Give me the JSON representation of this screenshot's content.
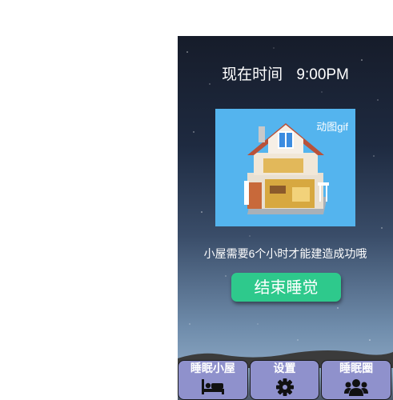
{
  "header": {
    "label": "现在时间",
    "time": "9:00PM"
  },
  "animation": {
    "label": "动图gif"
  },
  "message": "小屋需要6个小时才能建造成功哦",
  "end_button": "结束睡觉",
  "tabs": [
    {
      "label": "睡眠小屋",
      "icon": "bed-icon"
    },
    {
      "label": "设置",
      "icon": "gear-icon"
    },
    {
      "label": "睡眠圈",
      "icon": "users-icon"
    }
  ],
  "colors": {
    "accent": "#2ec98c",
    "tab_bg": "#8f91cc",
    "gif_bg": "#54b4ee"
  }
}
